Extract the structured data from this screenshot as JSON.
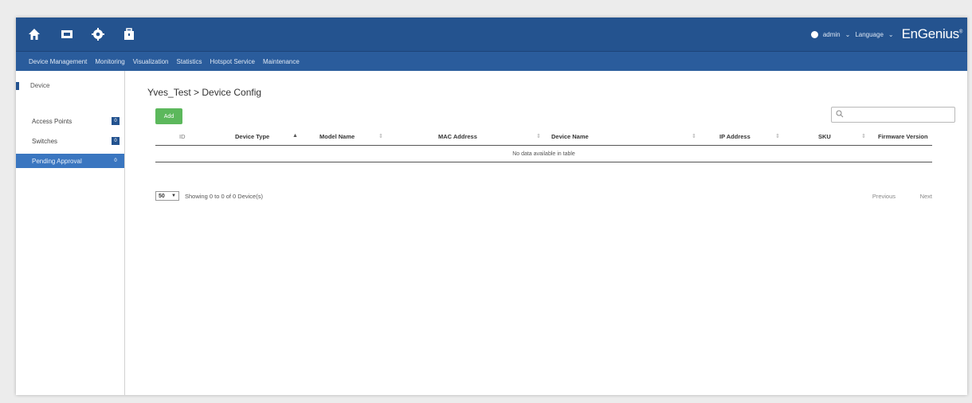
{
  "header": {
    "icons": [
      "home-icon",
      "monitor-icon",
      "gear-icon",
      "briefcase-icon"
    ],
    "user": "admin",
    "language": "Language",
    "brand": "EnGenius",
    "brand_mark": "®",
    "colors": {
      "topbar": "#24538f",
      "menubar": "#2a5c9c",
      "accent": "#3a76c0",
      "add": "#5cb85c"
    }
  },
  "menu": [
    "Device Management",
    "Monitoring",
    "Visualization",
    "Statistics",
    "Hotspot Service",
    "Maintenance"
  ],
  "sidebar": {
    "section": "Device",
    "items": [
      {
        "label": "Access Points",
        "count": "0"
      },
      {
        "label": "Switches",
        "count": "0"
      },
      {
        "label": "Pending Approval",
        "count": "0"
      }
    ]
  },
  "main": {
    "title": "Yves_Test > Device Config",
    "add_label": "Add",
    "search_placeholder": "",
    "columns": [
      "ID",
      "Device Type",
      "Model Name",
      "MAC Address",
      "Device Name",
      "IP Address",
      "SKU",
      "Firmware Version"
    ],
    "empty_message": "No data available in table",
    "page_size": "50",
    "showing": "Showing 0 to 0 of 0 Device(s)",
    "previous": "Previous",
    "next": "Next"
  }
}
